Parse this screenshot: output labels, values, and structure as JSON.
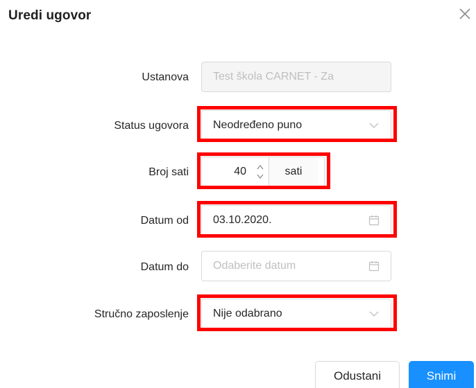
{
  "dialog": {
    "title": "Uredi ugovor"
  },
  "form": {
    "ustanova": {
      "label": "Ustanova",
      "value": "Test škola CARNET - Za"
    },
    "status": {
      "label": "Status ugovora",
      "value": "Neodređeno puno"
    },
    "broj_sati": {
      "label": "Broj sati",
      "value": "40",
      "unit": "sati"
    },
    "datum_od": {
      "label": "Datum od",
      "value": "03.10.2020."
    },
    "datum_do": {
      "label": "Datum do",
      "placeholder": "Odaberite datum"
    },
    "strucno": {
      "label": "Stručno zaposlenje",
      "value": "Nije odabrano"
    }
  },
  "footer": {
    "cancel_label": "Odustani",
    "save_label": "Snimi"
  },
  "colors": {
    "highlight": "#ff0000",
    "primary": "#1890ff",
    "border": "#d9d9d9",
    "disabled_bg": "#f5f5f5"
  },
  "icons": {
    "close": "close-icon",
    "dropdown": "chevron-down-icon",
    "calendar": "calendar-icon",
    "stepper_up": "caret-up-icon",
    "stepper_down": "caret-down-icon"
  }
}
